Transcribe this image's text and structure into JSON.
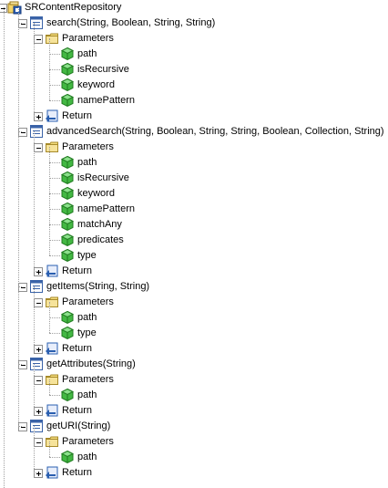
{
  "tree": {
    "root": {
      "label": "SRContentRepository",
      "icon": "repository-icon"
    },
    "methods": [
      {
        "label": "search(String, Boolean, String, String)",
        "parameters_label": "Parameters",
        "params": [
          "path",
          "isRecursive",
          "keyword",
          "namePattern"
        ],
        "return_label": "Return"
      },
      {
        "label": "advancedSearch(String, Boolean, String, String, Boolean, Collection, String)",
        "parameters_label": "Parameters",
        "params": [
          "path",
          "isRecursive",
          "keyword",
          "namePattern",
          "matchAny",
          "predicates",
          "type"
        ],
        "return_label": "Return"
      },
      {
        "label": "getItems(String, String)",
        "parameters_label": "Parameters",
        "params": [
          "path",
          "type"
        ],
        "return_label": "Return"
      },
      {
        "label": "getAttributes(String)",
        "parameters_label": "Parameters",
        "params": [
          "path"
        ],
        "return_label": "Return"
      },
      {
        "label": "getURI(String)",
        "parameters_label": "Parameters",
        "params": [
          "path"
        ],
        "return_label": "Return"
      }
    ]
  },
  "colors": {
    "tree_line": "#a0a0a0",
    "folder": "#f2da7a",
    "method_icon": "#3a63a8",
    "param_icon": "#38b038",
    "return_icon": "#2a5fb0"
  }
}
